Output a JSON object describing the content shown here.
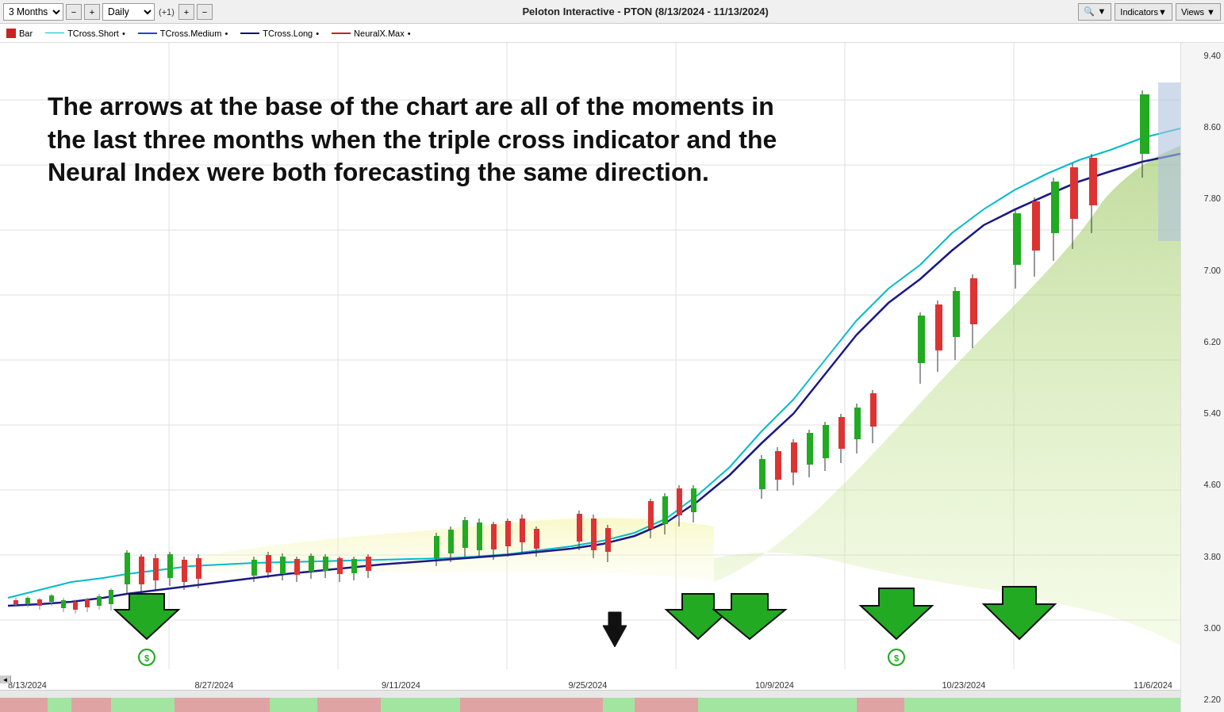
{
  "toolbar": {
    "months_value": "3 Months",
    "interval_value": "Daily",
    "plus_one_label": "(+1)",
    "title": "Peloton Interactive - PTON (8/13/2024 - 11/13/2024)",
    "indicators_label": "Indicators▼",
    "views_label": "Views ▼",
    "search_icon": "🔍"
  },
  "legend": {
    "items": [
      {
        "id": "bar",
        "label": "Bar",
        "type": "box",
        "color": "#cc0000"
      },
      {
        "id": "tcross-short",
        "label": "TCross.Short",
        "type": "line",
        "color": "#00cccc"
      },
      {
        "id": "tcross-medium",
        "label": "TCross.Medium",
        "type": "line",
        "color": "#0000cc"
      },
      {
        "id": "tcross-long",
        "label": "TCross.Long",
        "type": "line",
        "color": "#000066"
      },
      {
        "id": "neuralx-max",
        "label": "NeuralX.Max",
        "type": "line",
        "color": "#cc0000"
      }
    ]
  },
  "annotation": {
    "text": "The arrows at the base of the chart are all of the moments in the last three months when the triple cross indicator and the Neural Index were both forecasting the same direction."
  },
  "price_axis": {
    "labels": [
      "9.40",
      "8.60",
      "7.80",
      "7.00",
      "6.20",
      "5.40",
      "4.60",
      "3.80",
      "3.00",
      "2.20"
    ]
  },
  "date_axis": {
    "labels": [
      "8/13/2024",
      "8/27/2024",
      "9/11/2024",
      "9/25/2024",
      "10/9/2024",
      "10/23/2024",
      "11/6/2024"
    ]
  },
  "chart": {
    "background": "#ffffff",
    "grid_color": "#e8e8e8"
  }
}
